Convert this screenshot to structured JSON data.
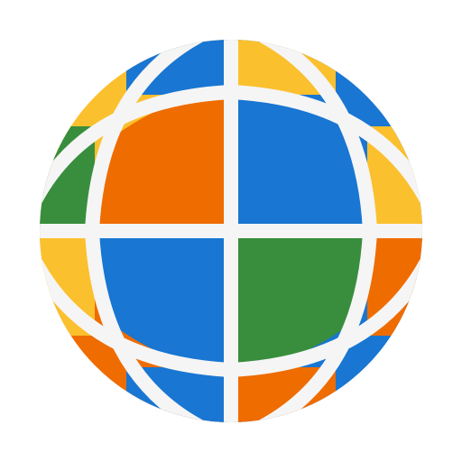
{
  "logo": {
    "icon": "globe-icon",
    "colors": {
      "blue": "#1976D2",
      "orange": "#EF6C00",
      "green": "#388E3C",
      "yellow": "#FBC02D",
      "grid": "#F5F5F5"
    }
  }
}
